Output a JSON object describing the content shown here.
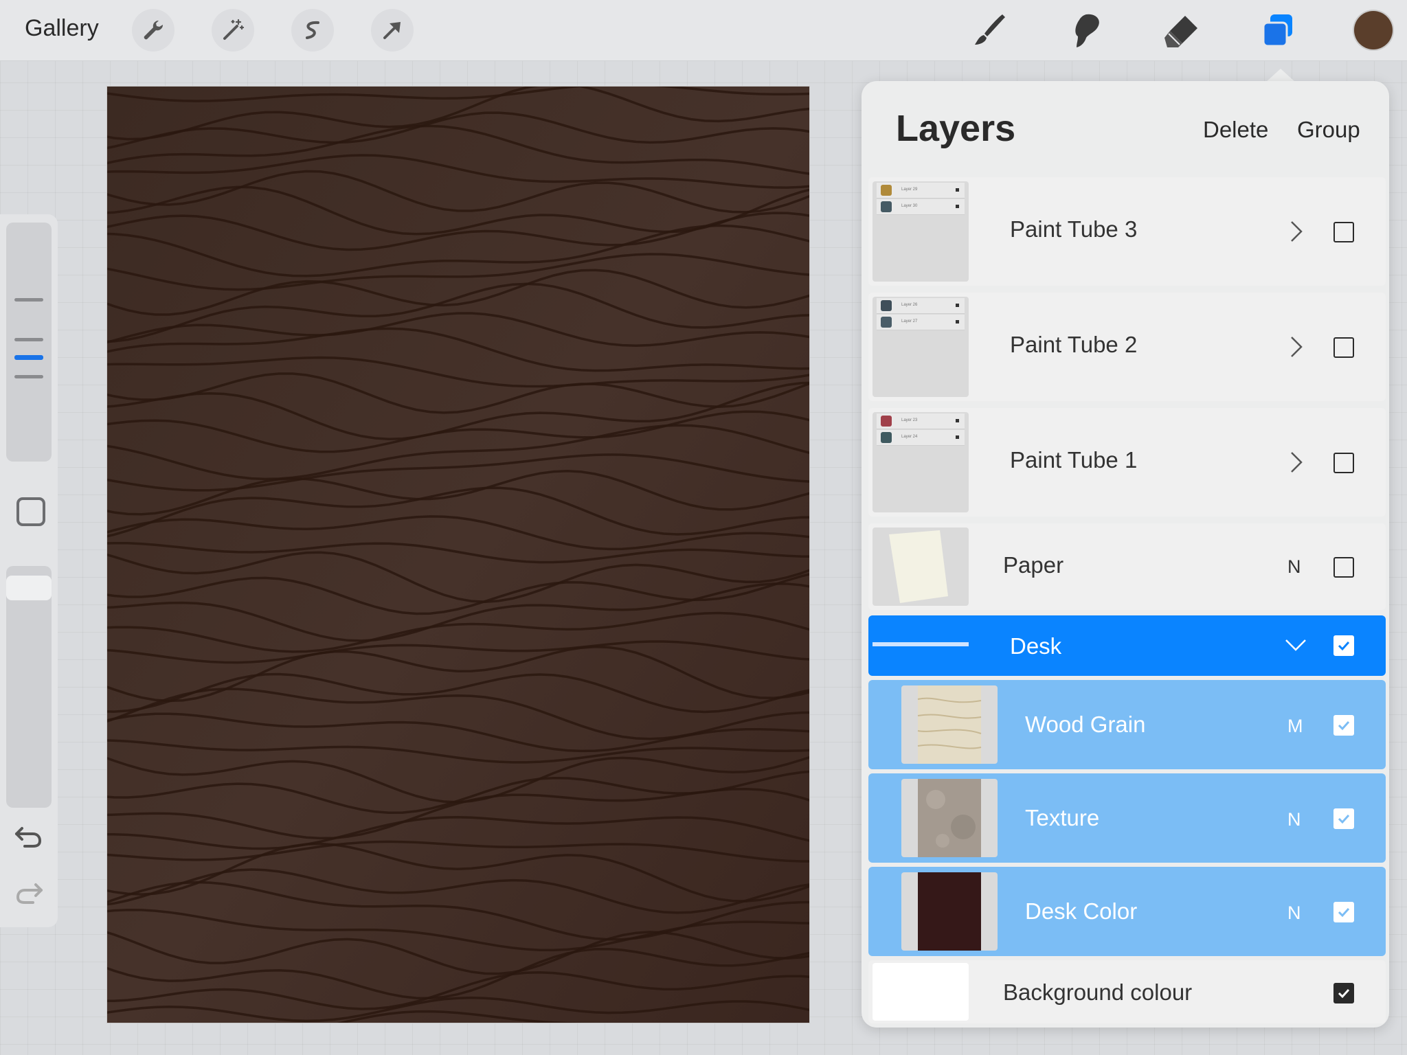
{
  "topbar": {
    "gallery_label": "Gallery",
    "tools_left": [
      "wrench-icon",
      "magic-wand-icon",
      "selection-icon",
      "transform-arrow-icon"
    ],
    "tools_right": [
      "brush-icon",
      "smudge-icon",
      "eraser-icon",
      "layers-icon"
    ],
    "active_color": "#5a3e2b",
    "accent": "#1a73e8"
  },
  "layers_panel": {
    "title": "Layers",
    "delete_label": "Delete",
    "group_label": "Group",
    "rows": [
      {
        "name": "Paint Tube 3",
        "type": "group",
        "collapsed": true,
        "visible": false,
        "sublayers": [
          {
            "name": "Layer 29",
            "mode": "N"
          },
          {
            "name": "Layer 30",
            "mode": "N"
          }
        ]
      },
      {
        "name": "Paint Tube 2",
        "type": "group",
        "collapsed": true,
        "visible": false,
        "sublayers": [
          {
            "name": "Layer 26",
            "mode": "N"
          },
          {
            "name": "Layer 27",
            "mode": "N"
          }
        ]
      },
      {
        "name": "Paint Tube 1",
        "type": "group",
        "collapsed": true,
        "visible": false,
        "sublayers": [
          {
            "name": "Layer 23",
            "mode": "N"
          },
          {
            "name": "Layer 24",
            "mode": "N"
          }
        ]
      },
      {
        "name": "Paper",
        "type": "layer",
        "mode": "N",
        "visible": false
      },
      {
        "name": "Desk",
        "type": "group",
        "collapsed": false,
        "visible": true,
        "selected": true
      },
      {
        "name": "Wood Grain",
        "type": "layer",
        "mode": "M",
        "visible": true,
        "child": true
      },
      {
        "name": "Texture",
        "type": "layer",
        "mode": "N",
        "visible": true,
        "child": true
      },
      {
        "name": "Desk Color",
        "type": "layer",
        "mode": "N",
        "visible": true,
        "child": true
      },
      {
        "name": "Background colour",
        "type": "background",
        "visible": true
      }
    ]
  },
  "colors": {
    "selected_row": "#0a84ff",
    "child_row": "#7bbdf5",
    "desk_color": "#351818"
  }
}
